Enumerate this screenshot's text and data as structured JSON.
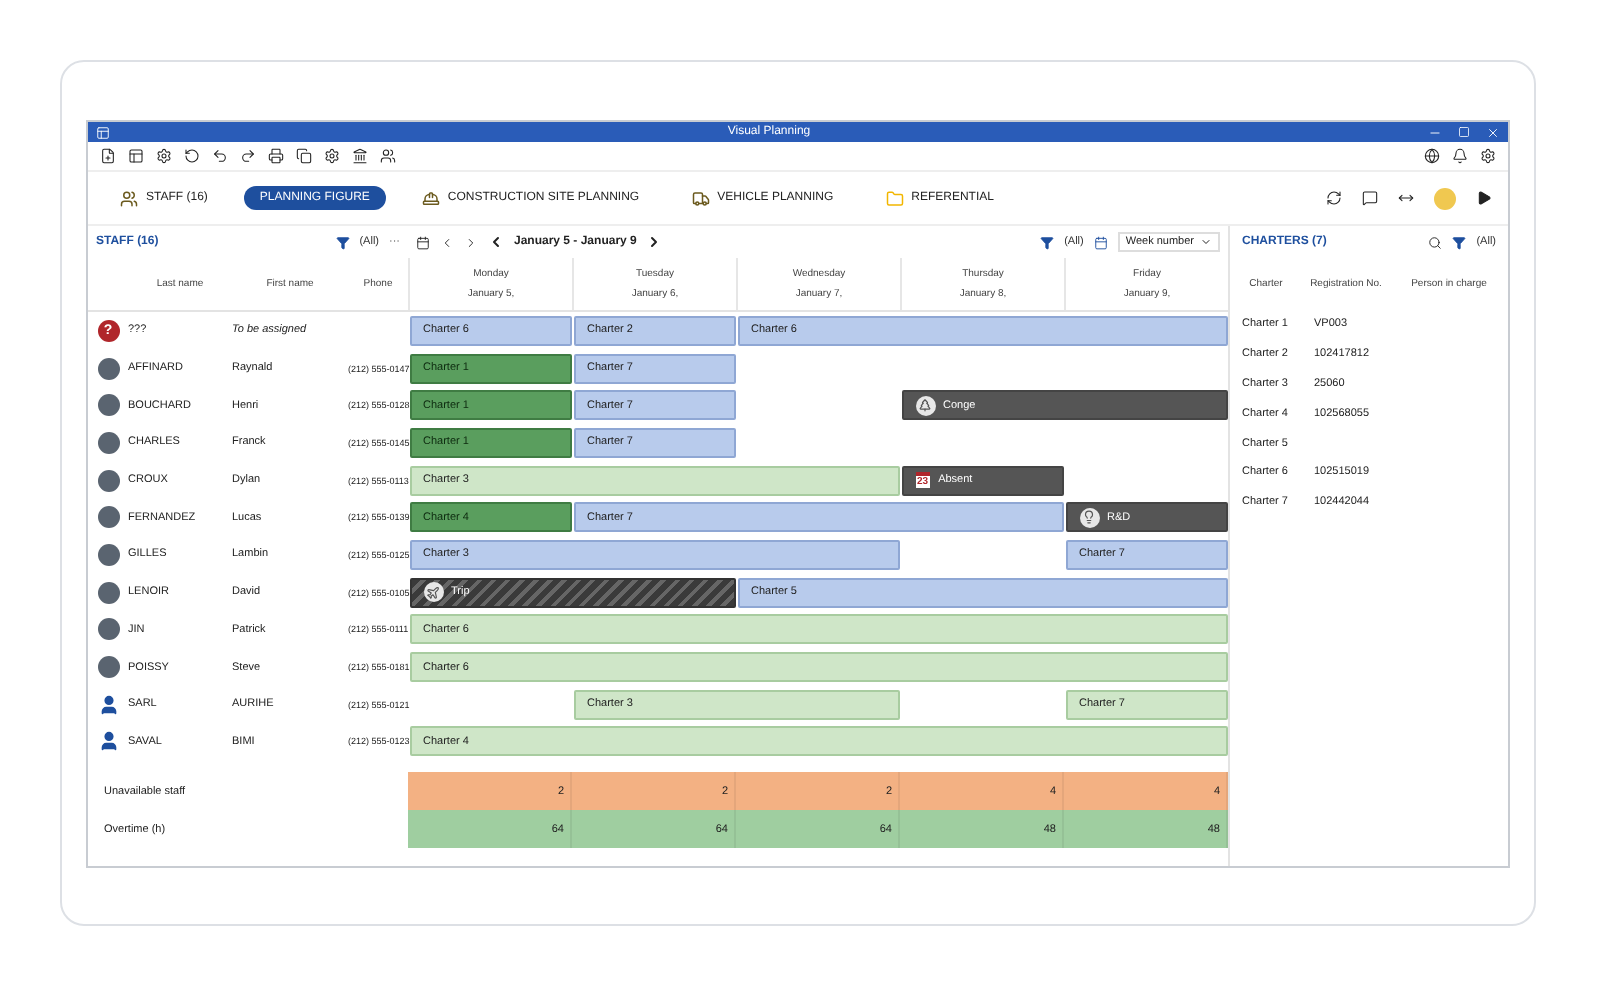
{
  "window": {
    "title": "Visual Planning"
  },
  "tabs": [
    {
      "label": "STAFF",
      "count": "(16)",
      "kind": "staff",
      "selected": false
    },
    {
      "label": "PLANNING FIGURE",
      "kind": "figure",
      "selected": true
    },
    {
      "label": "CONSTRUCTION SITE PLANNING",
      "kind": "site",
      "selected": false
    },
    {
      "label": "VEHICLE PLANNING",
      "kind": "vehicle",
      "selected": false
    },
    {
      "label": "REFERENTIAL",
      "kind": "folder",
      "selected": false
    }
  ],
  "staff_panel": {
    "title": "STAFF",
    "count": "(16)",
    "filter": "(All)",
    "more": "···",
    "columns": [
      "Last name",
      "First name",
      "Phone"
    ],
    "rows": [
      {
        "kind": "unknown",
        "mark": "?",
        "last": "???",
        "first": "To be assigned",
        "phone": ""
      },
      {
        "kind": "photo",
        "last": "AFFINARD",
        "first": "Raynald",
        "phone": "(212) 555-0147"
      },
      {
        "kind": "photo",
        "last": "BOUCHARD",
        "first": "Henri",
        "phone": "(212) 555-0128"
      },
      {
        "kind": "photo",
        "last": "CHARLES",
        "first": "Franck",
        "phone": "(212) 555-0145"
      },
      {
        "kind": "photo",
        "last": "CROUX",
        "first": "Dylan",
        "phone": "(212) 555-0113"
      },
      {
        "kind": "photo",
        "last": "FERNANDEZ",
        "first": "Lucas",
        "phone": "(212) 555-0139"
      },
      {
        "kind": "photo",
        "last": "GILLES",
        "first": "Lambin",
        "phone": "(212) 555-0125"
      },
      {
        "kind": "photo",
        "last": "LENOIR",
        "first": "David",
        "phone": "(212) 555-0105"
      },
      {
        "kind": "photo",
        "last": "JIN",
        "first": "Patrick",
        "phone": "(212) 555-0111"
      },
      {
        "kind": "photo",
        "last": "POISSY",
        "first": "Steve",
        "phone": "(212) 555-0181"
      },
      {
        "kind": "person",
        "last": "SARL",
        "first": "AURIHE",
        "phone": "(212) 555-0121"
      },
      {
        "kind": "person",
        "last": "SAVAL",
        "first": "BIMI",
        "phone": "(212) 555-0123"
      }
    ]
  },
  "planning": {
    "range": "January 5 - January 9",
    "filter": "(All)",
    "scale": "Week number",
    "days": [
      {
        "day": "Monday",
        "date": "January 5,"
      },
      {
        "day": "Tuesday",
        "date": "January 6,"
      },
      {
        "day": "Wednesday",
        "date": "January 7,"
      },
      {
        "day": "Thursday",
        "date": "January 8,"
      },
      {
        "day": "Friday",
        "date": "January 9,"
      }
    ],
    "lanes": [
      {
        "slots": [
          {
            "kind": "planned",
            "label": "Charter 6"
          },
          {
            "kind": "planned",
            "label": "Charter 2"
          },
          {
            "kind": "planned",
            "label": "Charter 6"
          },
          {
            "kind": "continued"
          },
          {
            "kind": "continued"
          }
        ]
      },
      {
        "slots": [
          {
            "kind": "confirmed",
            "label": "Charter 1"
          },
          {
            "kind": "planned",
            "label": "Charter 7"
          },
          {
            "kind": "empty"
          },
          {
            "kind": "empty"
          },
          {
            "kind": "empty"
          }
        ]
      },
      {
        "slots": [
          {
            "kind": "confirmed",
            "label": "Charter 1"
          },
          {
            "kind": "planned",
            "label": "Charter 7"
          },
          {
            "kind": "empty"
          },
          {
            "kind": "leave",
            "label": "Conge"
          },
          {
            "kind": "continued"
          }
        ]
      },
      {
        "slots": [
          {
            "kind": "confirmed",
            "label": "Charter 1"
          },
          {
            "kind": "planned",
            "label": "Charter 7"
          },
          {
            "kind": "empty"
          },
          {
            "kind": "empty"
          },
          {
            "kind": "empty"
          }
        ]
      },
      {
        "slots": [
          {
            "kind": "tentative",
            "label": "Charter 3"
          },
          {
            "kind": "continued"
          },
          {
            "kind": "continued"
          },
          {
            "kind": "absent",
            "label": "Absent",
            "badge": "23"
          },
          {
            "kind": "empty"
          }
        ]
      },
      {
        "slots": [
          {
            "kind": "confirmed",
            "label": "Charter 4"
          },
          {
            "kind": "planned",
            "label": "Charter 7"
          },
          {
            "kind": "continued"
          },
          {
            "kind": "continued"
          },
          {
            "kind": "project",
            "label": "R&D"
          }
        ]
      },
      {
        "slots": [
          {
            "kind": "planned",
            "label": "Charter 3"
          },
          {
            "kind": "continued"
          },
          {
            "kind": "continued"
          },
          {
            "kind": "empty"
          },
          {
            "kind": "planned",
            "label": "Charter 7"
          }
        ]
      },
      {
        "slots": [
          {
            "kind": "trip",
            "label": "Trip"
          },
          {
            "kind": "continued"
          },
          {
            "kind": "planned",
            "label": "Charter 5"
          },
          {
            "kind": "continued"
          },
          {
            "kind": "continued"
          }
        ]
      },
      {
        "slots": [
          {
            "kind": "tentative",
            "label": "Charter 6"
          },
          {
            "kind": "continued"
          },
          {
            "kind": "continued"
          },
          {
            "kind": "continued"
          },
          {
            "kind": "continued"
          }
        ]
      },
      {
        "slots": [
          {
            "kind": "tentative",
            "label": "Charter 6"
          },
          {
            "kind": "continued"
          },
          {
            "kind": "continued"
          },
          {
            "kind": "continued"
          },
          {
            "kind": "continued"
          }
        ]
      },
      {
        "slots": [
          {
            "kind": "empty"
          },
          {
            "kind": "tentative",
            "label": "Charter 3"
          },
          {
            "kind": "continued"
          },
          {
            "kind": "empty"
          },
          {
            "kind": "tentative",
            "label": "Charter 7"
          }
        ]
      },
      {
        "slots": [
          {
            "kind": "tentative",
            "label": "Charter 4"
          },
          {
            "kind": "continued"
          },
          {
            "kind": "continued"
          },
          {
            "kind": "continued"
          },
          {
            "kind": "continued"
          }
        ]
      }
    ],
    "summary": [
      {
        "label": "Unavailable staff",
        "kind": "unavailable",
        "values": [
          "2",
          "2",
          "2",
          "4",
          "4"
        ]
      },
      {
        "label": "Overtime (h)",
        "kind": "overtime",
        "values": [
          "64",
          "64",
          "64",
          "48",
          "48"
        ]
      }
    ]
  },
  "charters_panel": {
    "title": "CHARTERS",
    "count": "(7)",
    "filter": "(All)",
    "columns": [
      "Charter",
      "Registration No.",
      "Person in charge"
    ],
    "rows": [
      {
        "charter": "Charter 1",
        "registration": "VP003"
      },
      {
        "charter": "Charter 2",
        "registration": "102417812"
      },
      {
        "charter": "Charter 3",
        "registration": "25060"
      },
      {
        "charter": "Charter 4",
        "registration": "102568055"
      },
      {
        "charter": "Charter 5",
        "registration": ""
      },
      {
        "charter": "Charter 6",
        "registration": "102515019"
      },
      {
        "charter": "Charter 7",
        "registration": "102442044"
      }
    ]
  }
}
